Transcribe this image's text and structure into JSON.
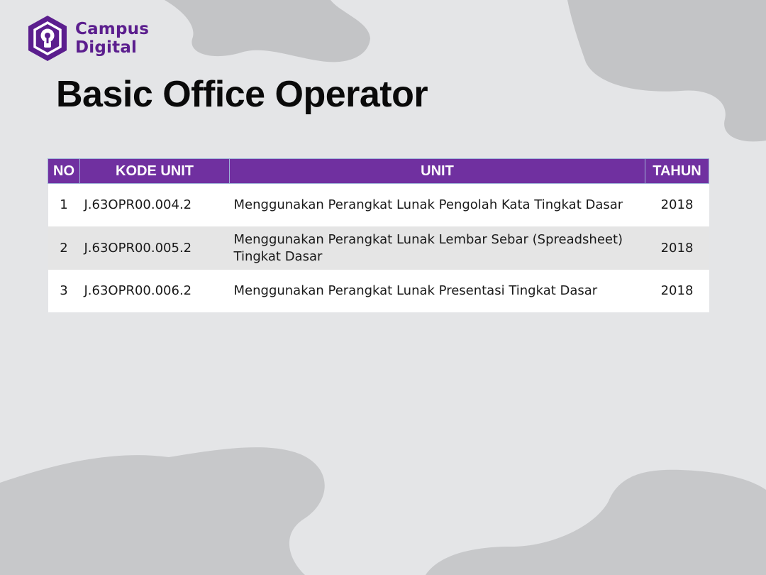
{
  "brand": {
    "name_line1": "Campus",
    "name_line2": "Digital",
    "color": "#5b1e8e"
  },
  "title": "Basic Office Operator",
  "table": {
    "header_color": "#7030a0",
    "columns": [
      "NO",
      "KODE UNIT",
      "UNIT",
      "TAHUN"
    ],
    "rows": [
      {
        "no": "1",
        "kode": "J.63OPR00.004.2",
        "unit": "Menggunakan Perangkat Lunak Pengolah Kata Tingkat Dasar",
        "tahun": "2018"
      },
      {
        "no": "2",
        "kode": "J.63OPR00.005.2",
        "unit": "Menggunakan Perangkat Lunak Lembar Sebar (Spreadsheet) Tingkat Dasar",
        "tahun": "2018"
      },
      {
        "no": "3",
        "kode": "J.63OPR00.006.2",
        "unit": "Menggunakan Perangkat Lunak Presentasi Tingkat Dasar",
        "tahun": "2018"
      }
    ]
  }
}
